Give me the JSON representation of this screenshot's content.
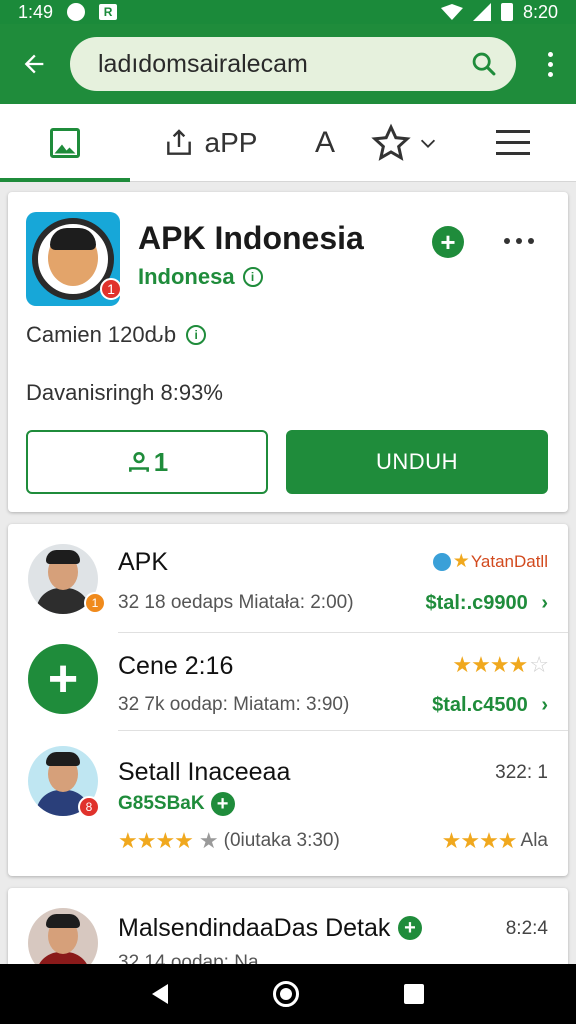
{
  "status_bar": {
    "time": "1:49",
    "clock": "8:20",
    "notif_badge": "R"
  },
  "search": {
    "value": "ladıdomsairalecam"
  },
  "tabs": {
    "app_label": "aPP",
    "a_label": "A"
  },
  "featured": {
    "title": "APK Indonesia",
    "subtitle": "Indonesa",
    "logo_badge": "1",
    "stat_line": "Camien 120ԃb",
    "progress_line": "Davanisringh 8:93%",
    "outline_btn_count": "1",
    "primary_label": "UNDUH"
  },
  "list": [
    {
      "title": "APK",
      "meta": "32 18 oedaps Miatała: 2:00)",
      "tag": "YatanDatll",
      "price": "$tal:.c9900",
      "badge": "1",
      "badge_color": "#f08a1c"
    },
    {
      "title": "Cene 2:16",
      "meta": "32 7k oodap: Miatam: 3:90)",
      "rating": 4,
      "price": "$tal.c4500"
    },
    {
      "title": "Setall Inaceeaa",
      "green_tag": "G85SBaK",
      "side_value": "322: 1",
      "meta": "(0iutaka 3:30)",
      "rating": 4,
      "right_label": "Ala",
      "badge": "8",
      "badge_color": "#e0322c"
    }
  ],
  "bottom_item": {
    "title": "MalsendindaaDas Detak",
    "side_value": "8:2:4",
    "meta": "32 14 oodap: Na"
  },
  "colors": {
    "primary": "#1f8c3b",
    "star": "#f0a81e"
  }
}
